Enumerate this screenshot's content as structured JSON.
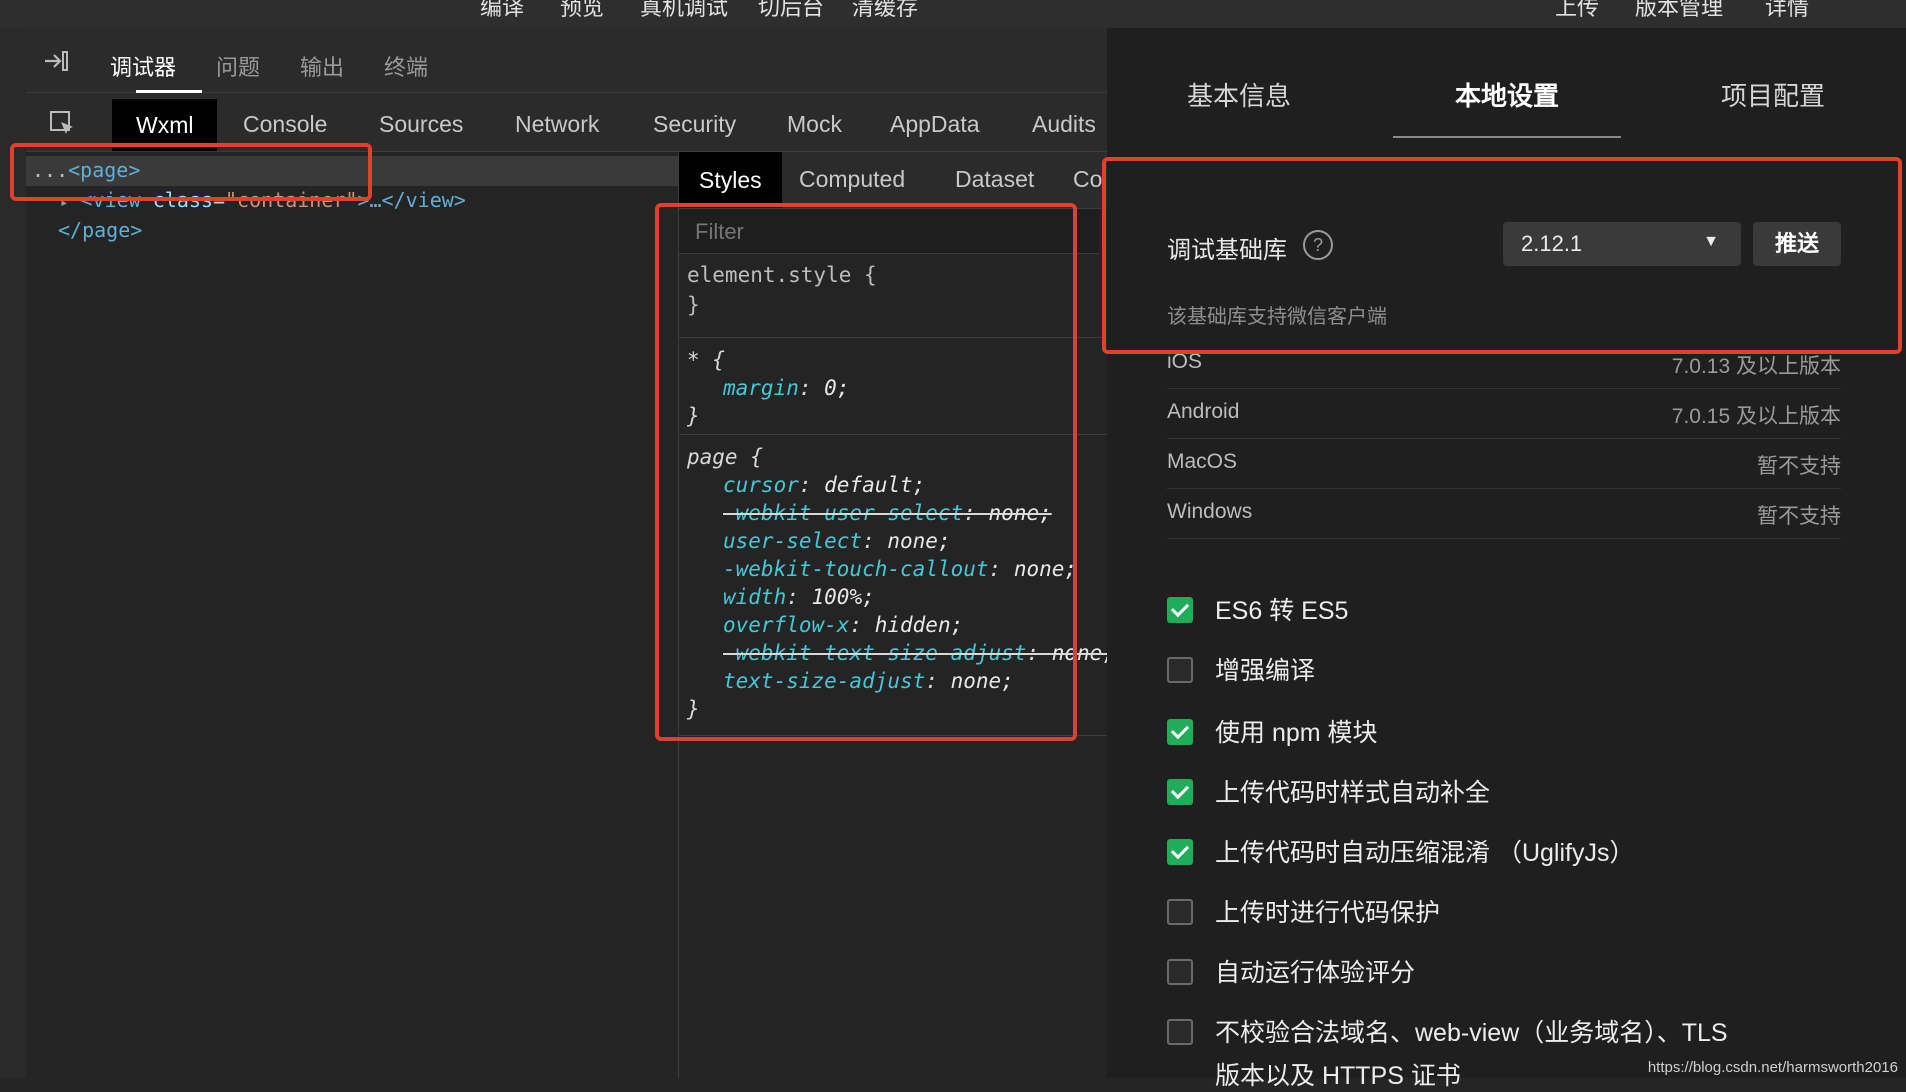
{
  "top_toolbar": {
    "left_items": [
      "编译",
      "预览",
      "真机调试",
      "切后台",
      "清缓存"
    ],
    "right_items": [
      "上传",
      "版本管理",
      "详情"
    ]
  },
  "debugger_tabs": {
    "collapse_icon": "collapse-panel-icon",
    "items": [
      "调试器",
      "问题",
      "输出",
      "终端"
    ],
    "active": "调试器"
  },
  "devtools_tabs": {
    "inspect_icon": "element-picker-icon",
    "items": [
      "Wxml",
      "Console",
      "Sources",
      "Network",
      "Security",
      "Mock",
      "AppData",
      "Audits"
    ],
    "active": "Wxml"
  },
  "wxml_tree": {
    "line1_prefix": "...",
    "line1": "<page>",
    "line2_arrow": "▸",
    "line2_open": "<view ",
    "line2_attr": "class",
    "line2_eq": "=",
    "line2_val": "\"container\"",
    "line2_close": ">…</view>",
    "line3": "</page>"
  },
  "styles_panel": {
    "tabs": [
      "Styles",
      "Computed",
      "Dataset",
      "Co"
    ],
    "active": "Styles",
    "filter_placeholder": "Filter",
    "rule1_selector": "element.style {",
    "rule1_end": "}",
    "rule2_selector": "* {",
    "rule2_prop": "margin",
    "rule2_val": "0;",
    "rule2_end": "}",
    "rule3_selector": "page {",
    "rule3_decls": [
      {
        "prop": "cursor",
        "val": "default;",
        "struck": false
      },
      {
        "prop": "-webkit-user-select",
        "val": "none;",
        "struck": true
      },
      {
        "prop": "user-select",
        "val": "none;",
        "struck": false
      },
      {
        "prop": "-webkit-touch-callout",
        "val": "none;",
        "struck": false
      },
      {
        "prop": "width",
        "val": "100%;",
        "struck": false
      },
      {
        "prop": "overflow-x",
        "val": "hidden;",
        "struck": false
      },
      {
        "prop": "-webkit-text-size-adjust",
        "val": "none;",
        "struck": true
      },
      {
        "prop": "text-size-adjust",
        "val": "none;",
        "struck": false
      }
    ],
    "rule3_end": "}"
  },
  "settings": {
    "tabs": [
      "基本信息",
      "本地设置",
      "项目配置"
    ],
    "active": "本地设置",
    "base_lib_label": "调试基础库",
    "help_glyph": "?",
    "version": "2.12.1",
    "caret": "▼",
    "push_label": "推送",
    "support_note": "该基础库支持微信客户端",
    "os_support": [
      {
        "os": "iOS",
        "value": "7.0.13 及以上版本"
      },
      {
        "os": "Android",
        "value": "7.0.15 及以上版本"
      },
      {
        "os": "MacOS",
        "value": "暂不支持"
      },
      {
        "os": "Windows",
        "value": "暂不支持"
      }
    ],
    "options": [
      {
        "label": "ES6 转 ES5",
        "checked": true
      },
      {
        "label": "增强编译",
        "checked": false
      },
      {
        "label": "使用 npm 模块",
        "checked": true
      },
      {
        "label": "上传代码时样式自动补全",
        "checked": true
      },
      {
        "label": "上传代码时自动压缩混淆 （UglifyJs）",
        "checked": true
      },
      {
        "label": "上传时进行代码保护",
        "checked": false
      },
      {
        "label": "自动运行体验评分",
        "checked": false
      },
      {
        "label": "不校验合法域名、web-view（业务域名）、TLS",
        "checked": false
      }
    ],
    "option_continuation": "版本以及 HTTPS 证书"
  },
  "colors": {
    "highlight_red": "#e0412d",
    "checkbox_green": "#1fad5a"
  },
  "watermark": "https://blog.csdn.net/harmsworth2016"
}
